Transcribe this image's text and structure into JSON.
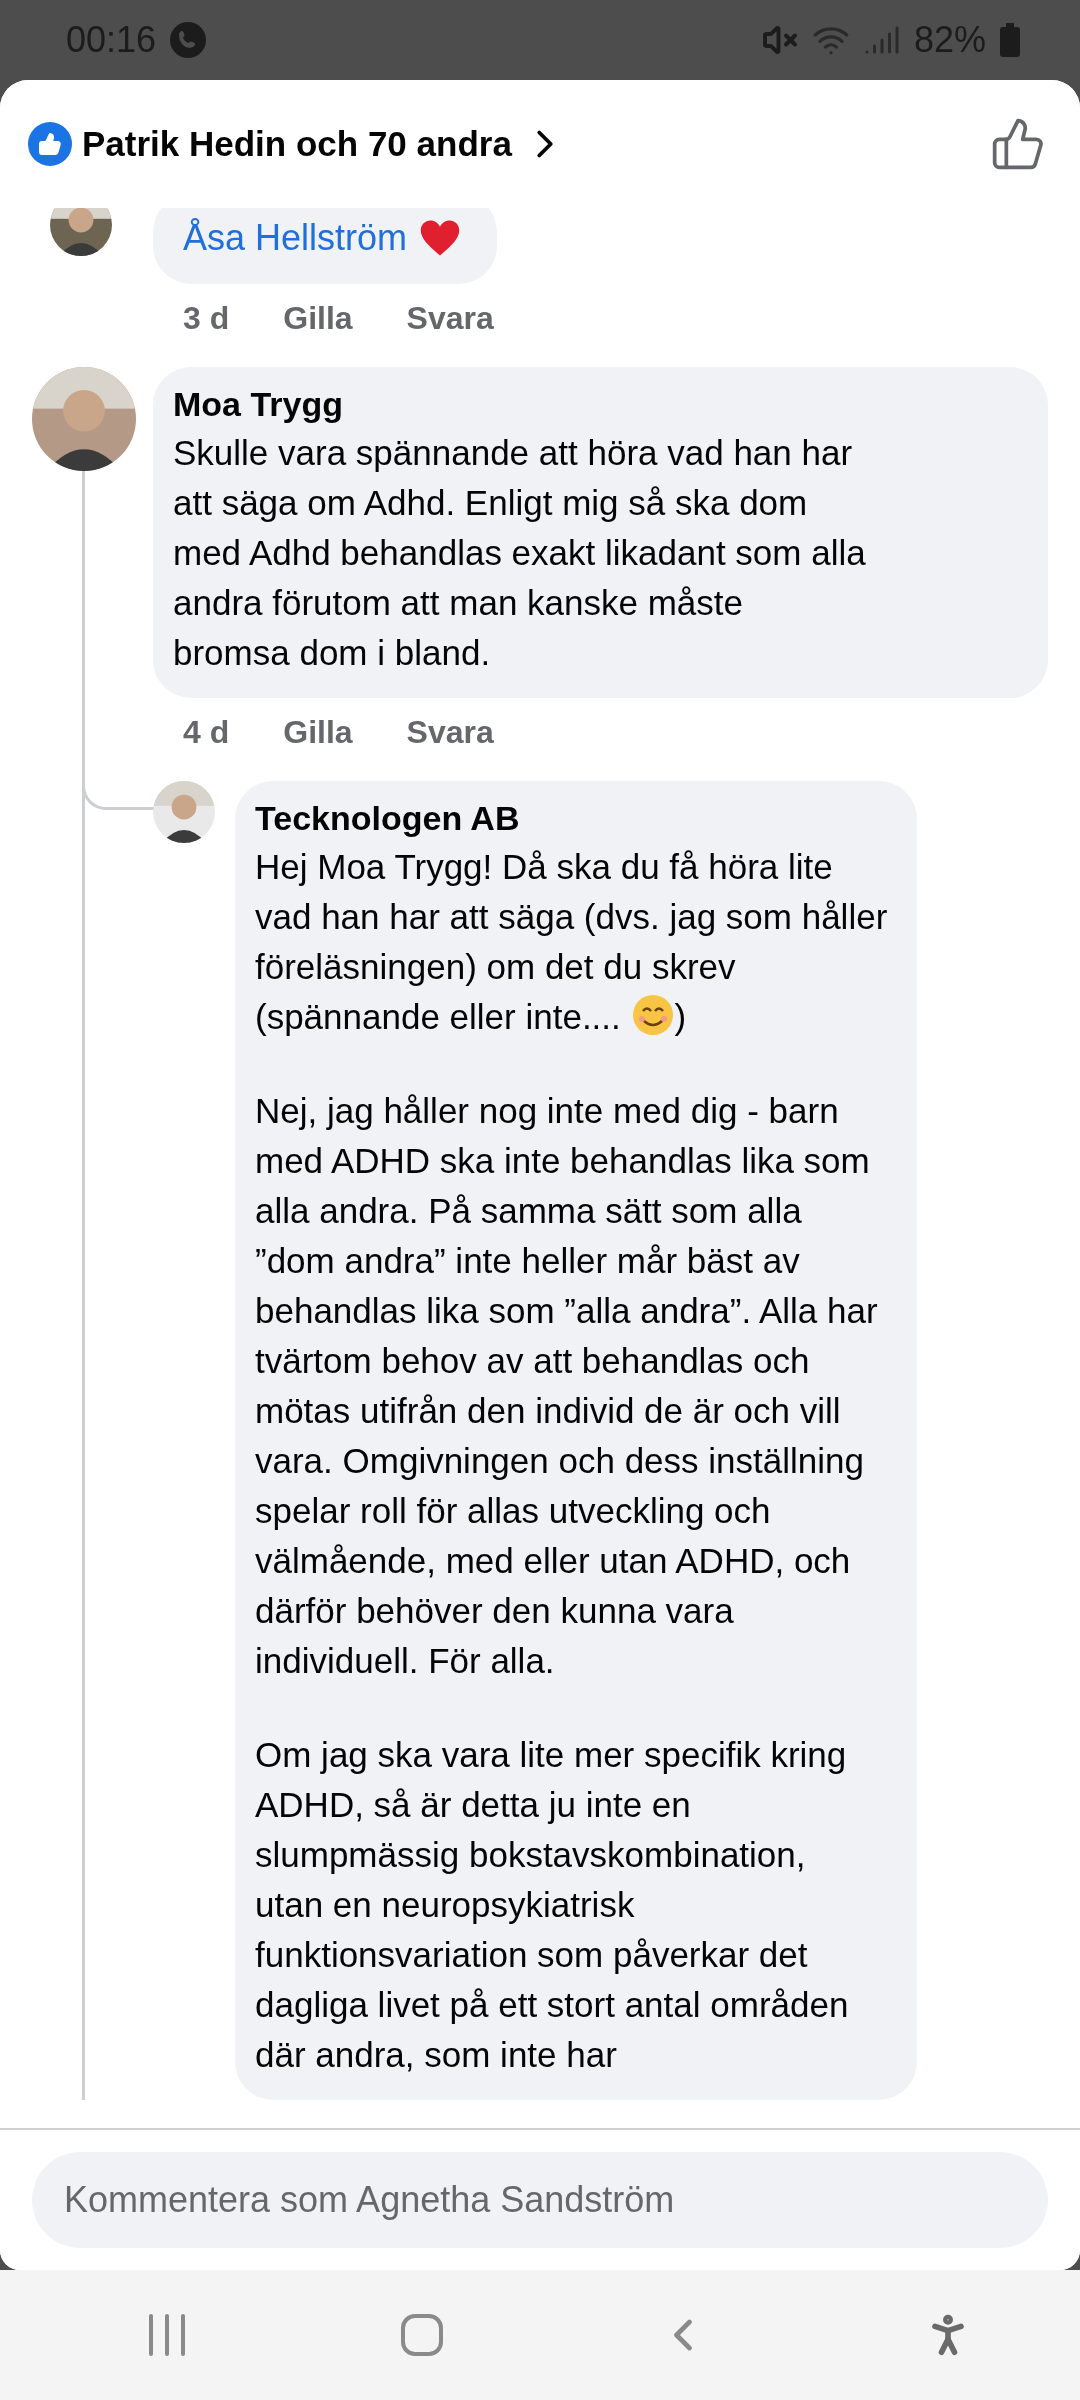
{
  "status_bar": {
    "time": "00:16",
    "battery": "82%"
  },
  "header": {
    "reactions_label": "Patrik Hedin och 70 andra"
  },
  "previous_comment": {
    "mention": "Åsa Hellström",
    "time": "3 d",
    "like": "Gilla",
    "reply": "Svara"
  },
  "comments": [
    {
      "author": "Moa Trygg",
      "paragraphs": [
        "Skulle vara spännande att höra vad han har\natt säga om Adhd. Enligt mig så ska dom\nmed Adhd behandlas exakt likadant som alla\nandra förutom att man kanske måste\nbromsa dom i bland."
      ],
      "time": "4 d",
      "like": "Gilla",
      "reply": "Svara",
      "children": [
        {
          "author": "Tecknologen AB",
          "paragraphs": [
            "Hej Moa Trygg! Då ska du få höra lite\nvad han har att säga (dvs. jag som håller\nföreläsningen) om det du skrev\n(spännande eller inte....",
            "Nej, jag håller nog inte med dig - barn\nmed ADHD ska inte behandlas lika som\nalla andra. På samma sätt som alla\n”dom andra” inte heller mår bäst av\nbehandlas lika som ”alla andra”. Alla har\ntvärtom behov av att behandlas och\nmötas utifrån den individ de är och vill\nvara. Omgivningen och dess inställning\nspelar roll för allas utveckling och\nvälmående, med eller utan ADHD, och\ndärför behöver den kunna vara\nindividuell. För alla.",
            "Om jag ska vara lite mer specifik kring\nADHD, så är detta ju inte en\nslumpmässig bokstavskombination,\nutan en neuropsykiatrisk\nfunktionsvariation som påverkar det\ndagliga livet på ett stort antal områden\ndär andra, som inte har"
          ],
          "emoji_after_first": ")"
        }
      ]
    }
  ],
  "composer": {
    "placeholder": "Kommentera som Agnetha Sandström"
  }
}
